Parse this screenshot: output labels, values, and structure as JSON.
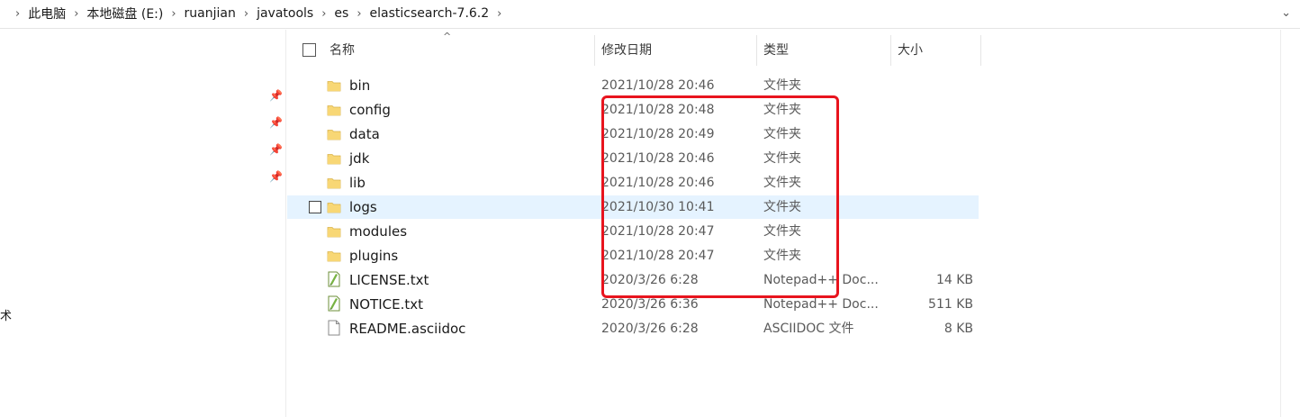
{
  "address": {
    "breadcrumbs": [
      "此电脑",
      "本地磁盘 (E:)",
      "ruanjian",
      "javatools",
      "es",
      "elasticsearch-7.6.2"
    ],
    "chevron_glyph": "›",
    "dropdown_glyph": "⌄"
  },
  "nav": {
    "pin_glyph": "📌",
    "partial_text": "术"
  },
  "columns": {
    "name": "名称",
    "date": "修改日期",
    "type": "类型",
    "size": "大小",
    "sort_glyph": "^"
  },
  "files": [
    {
      "name": "bin",
      "date": "2021/10/28 20:46",
      "type": "文件夹",
      "size": "",
      "icon": "folder-icon"
    },
    {
      "name": "config",
      "date": "2021/10/28 20:48",
      "type": "文件夹",
      "size": "",
      "icon": "folder-icon"
    },
    {
      "name": "data",
      "date": "2021/10/28 20:49",
      "type": "文件夹",
      "size": "",
      "icon": "folder-icon"
    },
    {
      "name": "jdk",
      "date": "2021/10/28 20:46",
      "type": "文件夹",
      "size": "",
      "icon": "folder-icon"
    },
    {
      "name": "lib",
      "date": "2021/10/28 20:46",
      "type": "文件夹",
      "size": "",
      "icon": "folder-icon"
    },
    {
      "name": "logs",
      "date": "2021/10/30 10:41",
      "type": "文件夹",
      "size": "",
      "icon": "folder-icon",
      "hovered": true
    },
    {
      "name": "modules",
      "date": "2021/10/28 20:47",
      "type": "文件夹",
      "size": "",
      "icon": "folder-icon"
    },
    {
      "name": "plugins",
      "date": "2021/10/28 20:47",
      "type": "文件夹",
      "size": "",
      "icon": "folder-icon"
    },
    {
      "name": "LICENSE.txt",
      "date": "2020/3/26 6:28",
      "type": "Notepad++ Doc...",
      "size": "14 KB",
      "icon": "notepadpp-file-icon"
    },
    {
      "name": "NOTICE.txt",
      "date": "2020/3/26 6:36",
      "type": "Notepad++ Doc...",
      "size": "511 KB",
      "icon": "notepadpp-file-icon"
    },
    {
      "name": "README.asciidoc",
      "date": "2020/3/26 6:28",
      "type": "ASCIIDOC 文件",
      "size": "8 KB",
      "icon": "generic-file-icon"
    }
  ],
  "colors": {
    "highlight": "#e8141e",
    "hover_row": "#e5f3ff",
    "folder": "#f8d775"
  }
}
